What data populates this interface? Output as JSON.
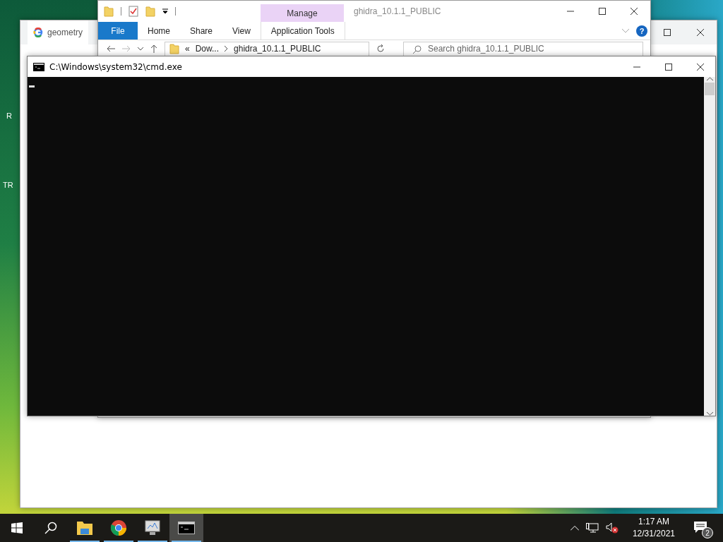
{
  "desktop": {
    "icon_labels": [
      "R",
      "TR"
    ]
  },
  "browser": {
    "tab": {
      "title": "geometry"
    }
  },
  "explorer": {
    "context_group": "Manage",
    "title": "ghidra_10.1.1_PUBLIC",
    "ribbon_tabs": [
      {
        "label": "File",
        "kind": "file"
      },
      {
        "label": "Home",
        "kind": "plain"
      },
      {
        "label": "Share",
        "kind": "plain"
      },
      {
        "label": "View",
        "kind": "plain"
      },
      {
        "label": "Application Tools",
        "kind": "contextual"
      }
    ],
    "help": "?",
    "address": {
      "overflow": "«",
      "crumbs": [
        "Dow...",
        "ghidra_10.1.1_PUBLIC"
      ]
    },
    "search": {
      "placeholder": "Search ghidra_10.1.1_PUBLIC"
    }
  },
  "console": {
    "title": "C:\\Windows\\system32\\cmd.exe"
  },
  "taskbar": {
    "apps": [
      {
        "kind": "explorer",
        "running": true,
        "selected": false
      },
      {
        "kind": "chrome",
        "running": true,
        "selected": false
      },
      {
        "kind": "monitor",
        "running": true,
        "selected": false
      },
      {
        "kind": "console",
        "running": true,
        "selected": true
      }
    ],
    "clock": {
      "time": "1:17 AM",
      "date": "12/31/2021"
    },
    "notifications": "2"
  }
}
